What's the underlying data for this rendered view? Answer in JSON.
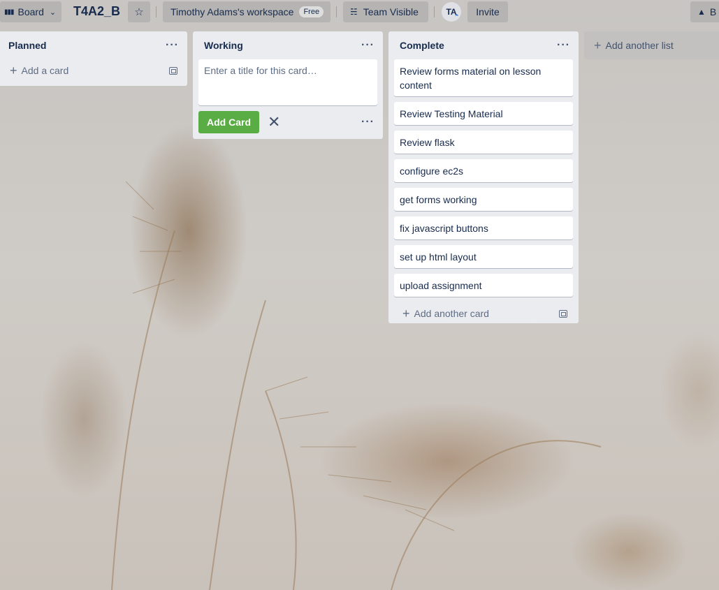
{
  "topbar": {
    "board_view": "Board",
    "board_title": "T4A2_B",
    "workspace": "Timothy Adams's workspace",
    "workspace_plan": "Free",
    "visibility": "Team Visible",
    "avatar_initials": "TA",
    "invite": "Invite",
    "right_partial": "B"
  },
  "lists": [
    {
      "name": "Planned",
      "add_card": "Add a card"
    },
    {
      "name": "Working",
      "composer_placeholder": "Enter a title for this card…",
      "add_button": "Add Card"
    },
    {
      "name": "Complete",
      "cards": [
        "Review forms material on lesson content",
        "Review Testing Material",
        "Review flask",
        "configure ec2s",
        "get forms working",
        "fix javascript buttons",
        "set up html layout",
        "upload assignment"
      ],
      "add_card": "Add another card"
    }
  ],
  "add_list": "Add another list",
  "colors": {
    "list_bg": "#ebecf0",
    "add_button": "#5aac44",
    "text": "#172b4d"
  }
}
